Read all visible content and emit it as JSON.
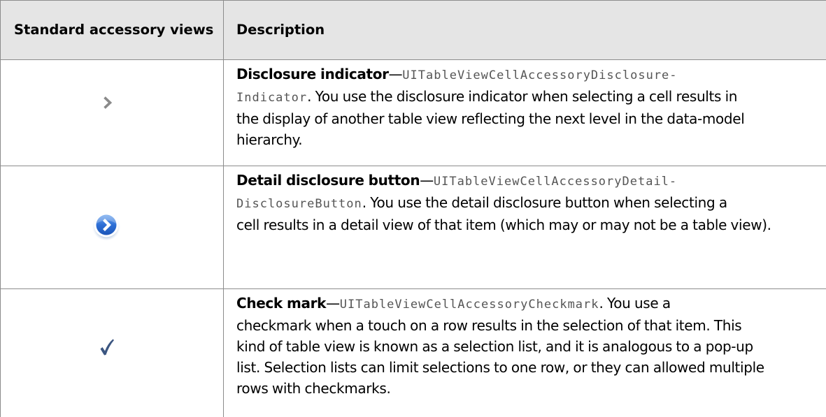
{
  "table": {
    "header": {
      "col1": "Standard accessory views",
      "col2": "Description"
    },
    "rows": [
      {
        "icon": "disclosure-indicator-icon",
        "term": "Disclosure indicator",
        "dash": "—",
        "code_line1": "UITableViewCellAccessoryDisclosure-",
        "code_line2": "Indicator",
        "text_line1": ". You use the disclosure indicator when selecting a cell results in",
        "text_line2": "the display of another table view reflecting the next level in the data-model",
        "text_line3": "hierarchy."
      },
      {
        "icon": "detail-disclosure-button-icon",
        "term": "Detail disclosure button",
        "dash": "—",
        "code_line1": "UITableViewCellAccessoryDetail-",
        "code_line2": "DisclosureButton",
        "text_line1": ". You use the detail disclosure button when selecting a",
        "text_line2": "cell results in a detail view of that item (which may or may not be a table view)."
      },
      {
        "icon": "checkmark-icon",
        "term": "Check mark",
        "dash": "—",
        "code_line1": "UITableViewCellAccessoryCheckmark",
        "text_line1": ". You use a",
        "text_line2": "checkmark when a touch on a row results in the selection of that item. This",
        "text_line3": "kind of table view is known as a selection list, and it is analogous to a pop-up",
        "text_line4": "list. Selection lists can limit selections to one row, or they can allowed multiple",
        "text_line5": "rows with checkmarks."
      }
    ]
  },
  "colors": {
    "header_bg": "#e5e5e5",
    "border": "#8c8c8c",
    "disclosure_gray": "#8a8a8a",
    "button_blue": "#2a6fd0",
    "checkmark_blue": "#3b5681"
  }
}
